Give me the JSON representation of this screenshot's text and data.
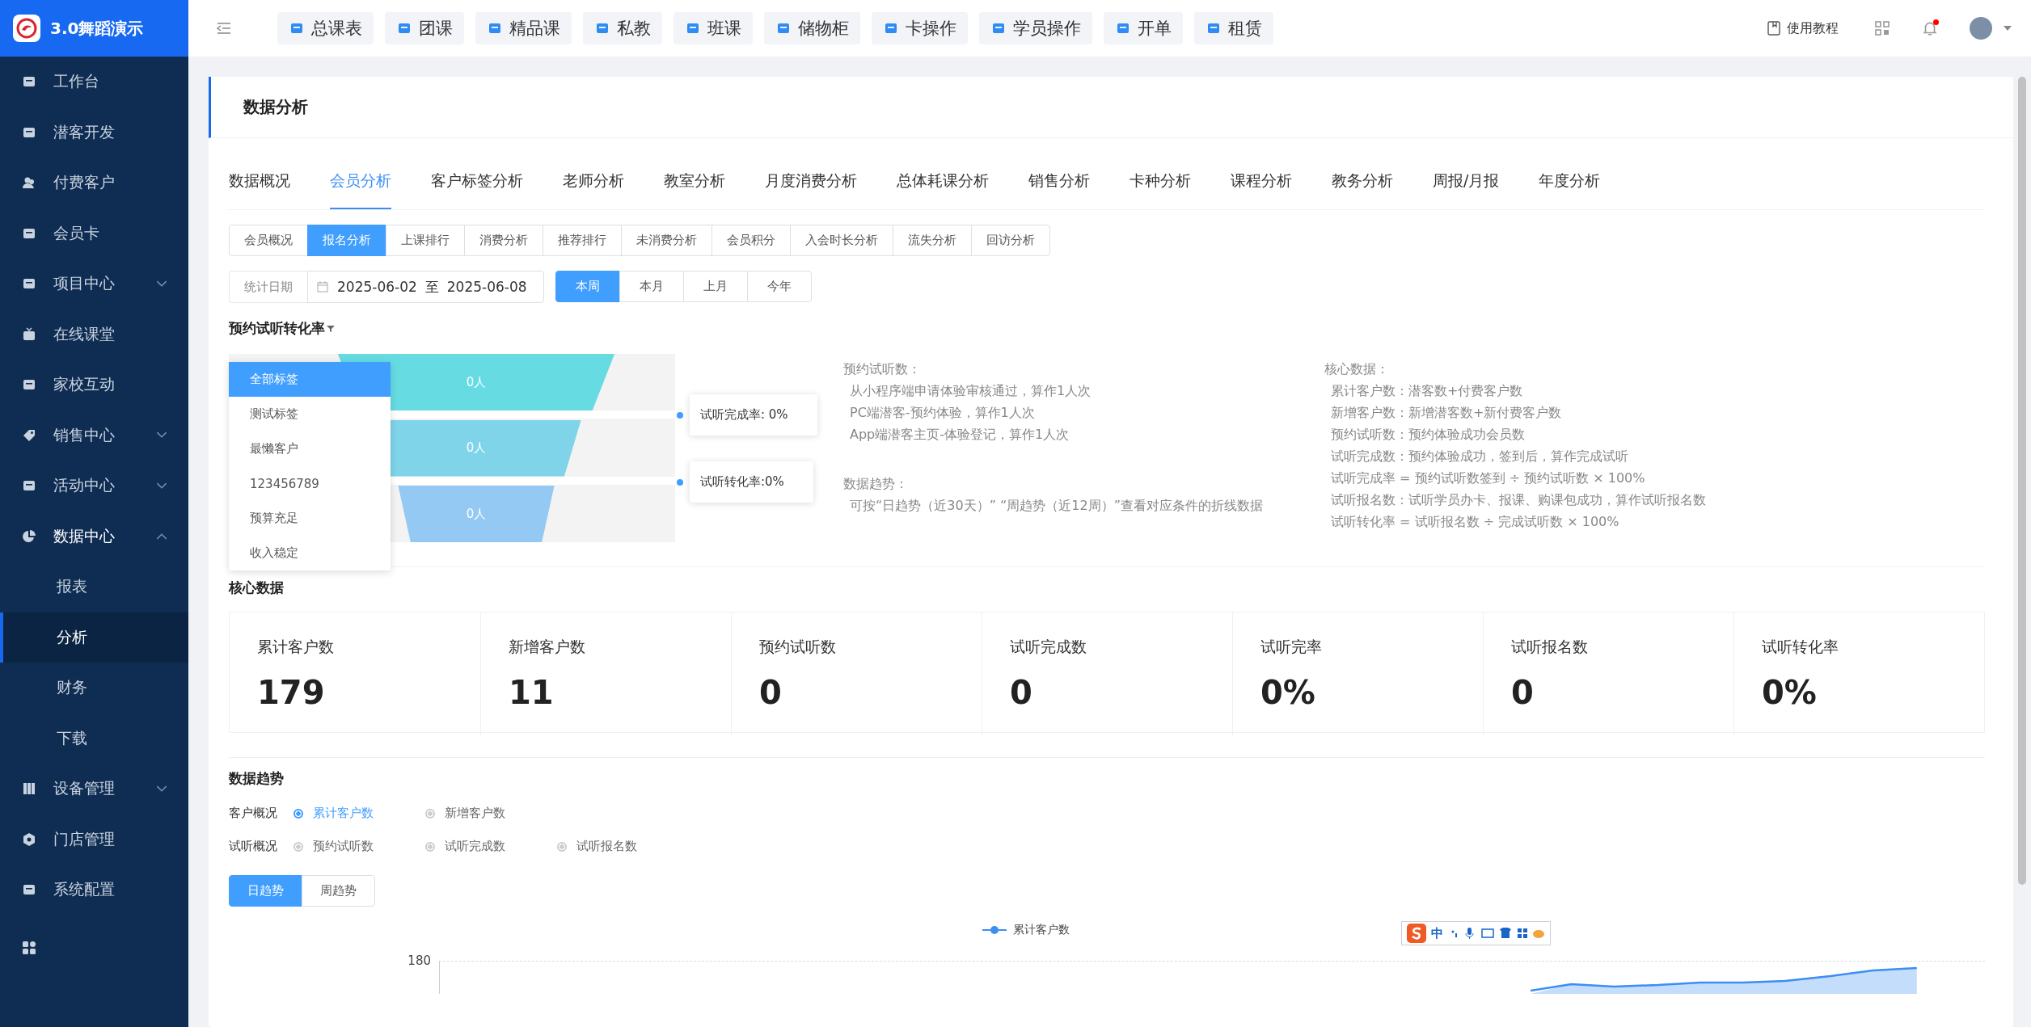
{
  "brand": {
    "title": "3.0舞蹈演示"
  },
  "sidebar": {
    "items": [
      {
        "label": "工作台"
      },
      {
        "label": "潜客开发"
      },
      {
        "label": "付费客户"
      },
      {
        "label": "会员卡"
      },
      {
        "label": "项目中心",
        "expanded": false
      },
      {
        "label": "在线课堂"
      },
      {
        "label": "家校互动"
      },
      {
        "label": "销售中心",
        "expanded": false
      },
      {
        "label": "活动中心",
        "expanded": false
      },
      {
        "label": "数据中心",
        "expanded": true,
        "children": [
          {
            "label": "报表",
            "selected": false
          },
          {
            "label": "分析",
            "selected": true
          },
          {
            "label": "财务",
            "selected": false
          },
          {
            "label": "下载",
            "selected": false
          }
        ]
      },
      {
        "label": "设备管理",
        "expanded": false
      },
      {
        "label": "门店管理"
      },
      {
        "label": "系统配置"
      }
    ]
  },
  "toolbar": {
    "buttons": [
      {
        "label": "总课表"
      },
      {
        "label": "团课"
      },
      {
        "label": "精品课"
      },
      {
        "label": "私教"
      },
      {
        "label": "班课"
      },
      {
        "label": "储物柜"
      },
      {
        "label": "卡操作"
      },
      {
        "label": "学员操作"
      },
      {
        "label": "开单"
      },
      {
        "label": "租赁"
      }
    ],
    "help": "使用教程",
    "notification": true
  },
  "page": {
    "title": "数据分析"
  },
  "tabs": [
    {
      "label": "数据概况",
      "selected": false
    },
    {
      "label": "会员分析",
      "selected": true
    },
    {
      "label": "客户标签分析",
      "selected": false
    },
    {
      "label": "老师分析",
      "selected": false
    },
    {
      "label": "教室分析",
      "selected": false
    },
    {
      "label": "月度消费分析",
      "selected": false
    },
    {
      "label": "总体耗课分析",
      "selected": false
    },
    {
      "label": "销售分析",
      "selected": false
    },
    {
      "label": "卡种分析",
      "selected": false
    },
    {
      "label": "课程分析",
      "selected": false
    },
    {
      "label": "教务分析",
      "selected": false
    },
    {
      "label": "周报/月报",
      "selected": false
    },
    {
      "label": "年度分析",
      "selected": false
    }
  ],
  "sub_tabs": [
    {
      "label": "会员概况",
      "selected": false
    },
    {
      "label": "报名分析",
      "selected": true
    },
    {
      "label": "上课排行",
      "selected": false
    },
    {
      "label": "消费分析",
      "selected": false
    },
    {
      "label": "推荐排行",
      "selected": false
    },
    {
      "label": "未消费分析",
      "selected": false
    },
    {
      "label": "会员积分",
      "selected": false
    },
    {
      "label": "入会时长分析",
      "selected": false
    },
    {
      "label": "流失分析",
      "selected": false
    },
    {
      "label": "回访分析",
      "selected": false
    }
  ],
  "date_filter": {
    "label": "统计日期",
    "start": "2025-06-02",
    "separator": "至",
    "end": "2025-06-08",
    "ranges": [
      {
        "label": "本周",
        "selected": true
      },
      {
        "label": "本月",
        "selected": false
      },
      {
        "label": "上月",
        "selected": false
      },
      {
        "label": "今年",
        "selected": false
      }
    ]
  },
  "funnel": {
    "title": "预约试听转化率",
    "stages": [
      {
        "label": "0人",
        "color": "#66dbe2"
      },
      {
        "label": "0人",
        "color": "#7fd4ea"
      },
      {
        "label": "0人",
        "color": "#93c9f2"
      }
    ],
    "callouts": [
      "试听完成率: 0%",
      "试听转化率:0%"
    ],
    "tag_menu": [
      {
        "label": "全部标签",
        "selected": true
      },
      {
        "label": "测试标签",
        "selected": false
      },
      {
        "label": "最懒客户",
        "selected": false
      },
      {
        "label": "123456789",
        "selected": false
      },
      {
        "label": "预算充足",
        "selected": false
      },
      {
        "label": "收入稳定",
        "selected": false
      }
    ]
  },
  "notes": [
    {
      "heading": "预约试听数：",
      "lines": [
        "从小程序端申请体验审核通过，算作1人次",
        "PC端潜客-预约体验，算作1人次",
        "App端潜客主页-体验登记，算作1人次"
      ]
    },
    {
      "heading": "数据趋势：",
      "lines": [
        "可按“日趋势（近30天）”  “周趋势（近12周）”查看对应条件的折线数据"
      ]
    },
    {
      "heading": "核心数据：",
      "lines": [
        "累计客户数：潜客数+付费客户数",
        "新增客户数：新增潜客数+新付费客户数",
        "预约试听数：预约体验成功会员数",
        "试听完成数：预约体验成功，签到后，算作完成试听",
        "试听完成率 = 预约试听数签到 ÷ 预约试听数 × 100%",
        "试听报名数：试听学员办卡、报课、购课包成功，算作试听报名数",
        "试听转化率 = 试听报名数 ÷ 完成试听数 × 100%"
      ]
    }
  ],
  "core": {
    "title": "核心数据",
    "stats": [
      {
        "label": "累计客户数",
        "value": "179"
      },
      {
        "label": "新增客户数",
        "value": "11"
      },
      {
        "label": "预约试听数",
        "value": "0"
      },
      {
        "label": "试听完成数",
        "value": "0"
      },
      {
        "label": "试听完率",
        "value": "0%"
      },
      {
        "label": "试听报名数",
        "value": "0"
      },
      {
        "label": "试听转化率",
        "value": "0%"
      }
    ]
  },
  "trend": {
    "title": "数据趋势",
    "groups": [
      {
        "label": "客户概况",
        "options": [
          {
            "label": "累计客户数",
            "selected": true
          },
          {
            "label": "新增客户数",
            "selected": false
          }
        ]
      },
      {
        "label": "试听概况",
        "options": [
          {
            "label": "预约试听数",
            "selected": false
          },
          {
            "label": "试听完成数",
            "selected": false
          },
          {
            "label": "试听报名数",
            "selected": false
          }
        ]
      }
    ],
    "modes": [
      {
        "label": "日趋势",
        "selected": true
      },
      {
        "label": "周趋势",
        "selected": false
      }
    ],
    "legend": "累计客户数",
    "y_tick": "180"
  },
  "ime_toolbar": {
    "label": "中"
  }
}
